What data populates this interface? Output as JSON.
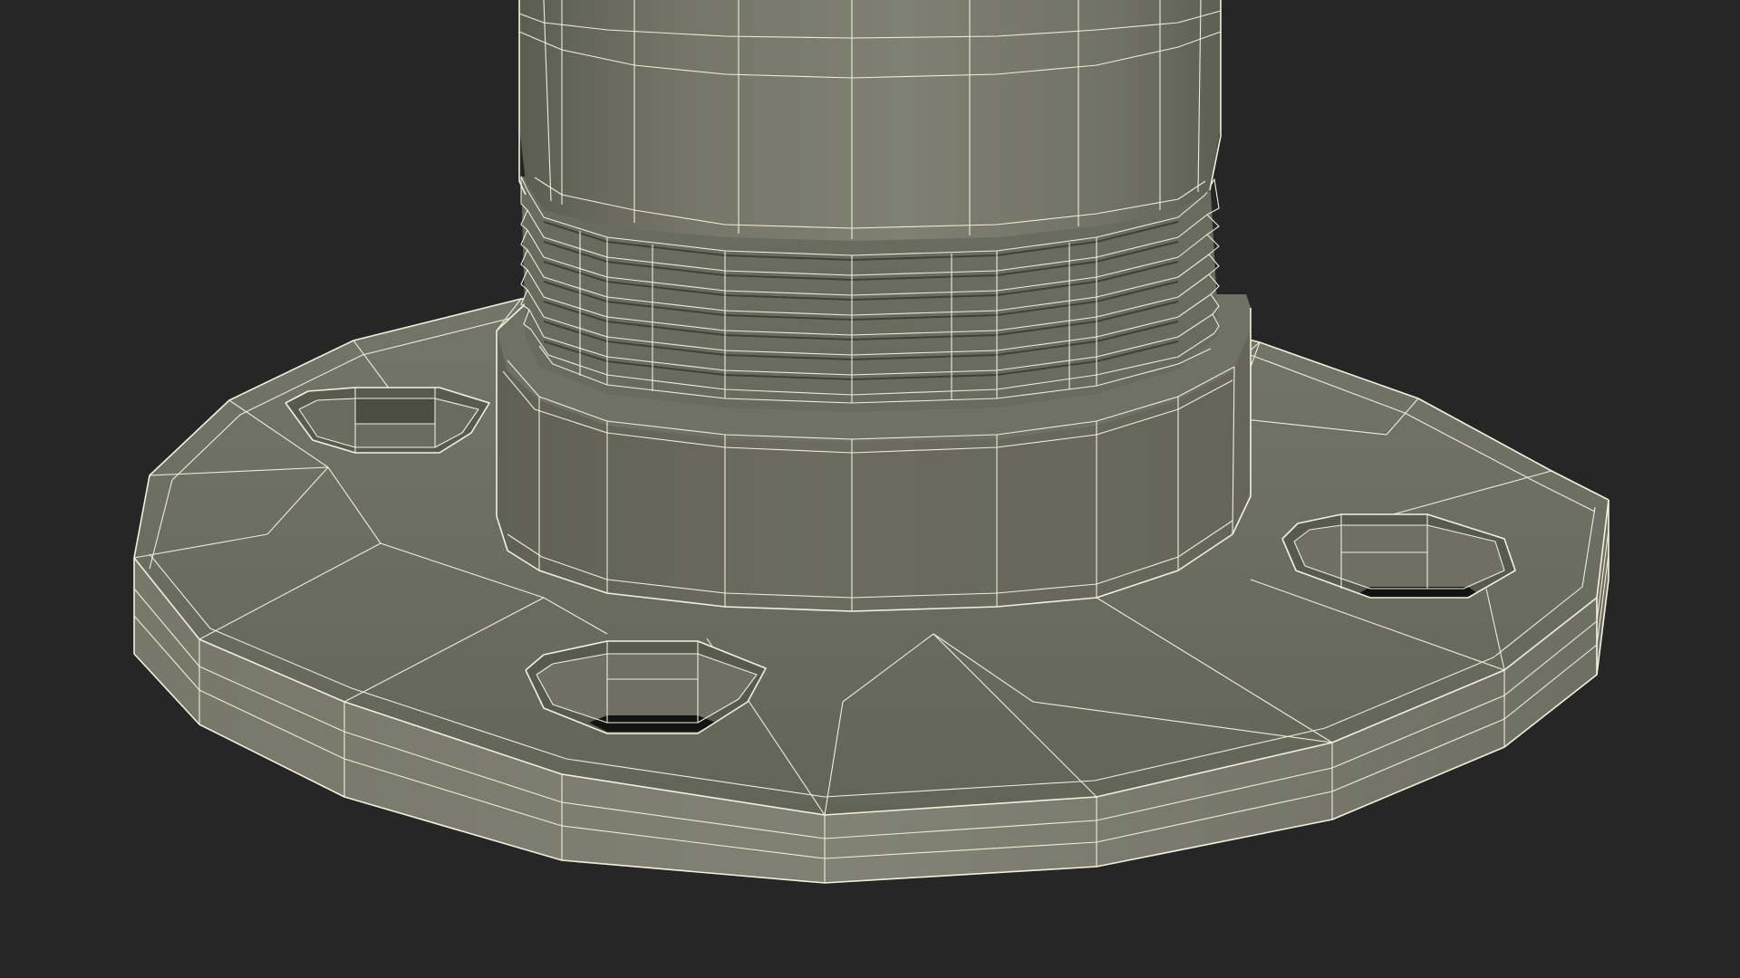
{
  "scene": {
    "subject": "flange-base-wireframe-render",
    "colors": {
      "background": "#262626",
      "surface_light": "#7d7e70",
      "surface_mid": "#6c6d60",
      "surface_dark": "#5b5c50",
      "wire": "#eeeed6",
      "hole": "#161616"
    },
    "features": {
      "bolt_holes": 3,
      "thread_rings": 10,
      "radial_segments": 16
    }
  }
}
